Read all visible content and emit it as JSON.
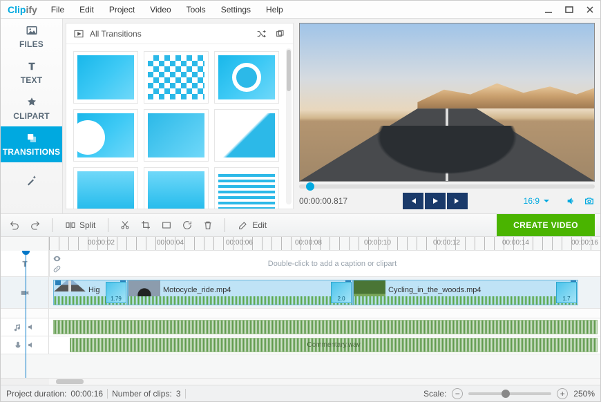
{
  "app": {
    "logo_a": "Clip",
    "logo_b": "ify"
  },
  "menu": [
    "File",
    "Edit",
    "Project",
    "Video",
    "Tools",
    "Settings",
    "Help"
  ],
  "sidebar": [
    {
      "label": "FILES",
      "icon": "image"
    },
    {
      "label": "TEXT",
      "icon": "text"
    },
    {
      "label": "CLIPART",
      "icon": "star"
    },
    {
      "label": "TRANSITIONS",
      "icon": "copy",
      "active": true
    },
    {
      "label": "",
      "icon": "wand"
    }
  ],
  "panel": {
    "title": "All Transitions"
  },
  "preview": {
    "timecode": "00:00:00.817",
    "aspect": "16:9"
  },
  "toolbar": {
    "split": "Split",
    "edit": "Edit",
    "create": "CREATE VIDEO"
  },
  "ruler": [
    "00:00:02",
    "00:00:04",
    "00:00:06",
    "00:00:08",
    "00:00:10",
    "00:00:12",
    "00:00:14",
    "00:00:16"
  ],
  "text_hint": "Double-click to add a caption or clipart",
  "clips": [
    {
      "label": "Hig",
      "badge": "1.79"
    },
    {
      "label": "Motocycle_ride.mp4",
      "badge": "2.0"
    },
    {
      "label": "Cycling_in_the_woods.mp4",
      "badge": "1.7"
    }
  ],
  "commentary": "Commentary.wav",
  "status": {
    "dur_label": "Project duration:",
    "dur": "00:00:16",
    "clips_label": "Number of clips:",
    "clips": "3",
    "scale_label": "Scale:",
    "zoom": "250%"
  }
}
